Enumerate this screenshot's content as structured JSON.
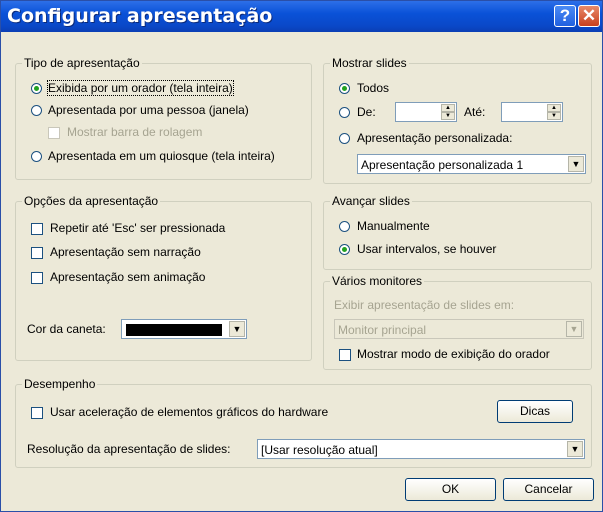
{
  "window": {
    "title": "Configurar apresentação",
    "help_icon": "help-question-icon",
    "close_icon": "close-x-icon"
  },
  "tipo": {
    "legend": "Tipo de apresentação",
    "options": [
      {
        "label": "Exibida por um orador (tela inteira)",
        "selected": true
      },
      {
        "label": "Apresentada por uma pessoa (janela)",
        "selected": false
      },
      {
        "label": "Apresentada em um quiosque (tela inteira)",
        "selected": false
      }
    ],
    "scrollbar_label": "Mostrar barra de rolagem"
  },
  "mostrar": {
    "legend": "Mostrar slides",
    "todos": "Todos",
    "de": "De:",
    "ate": "Até:",
    "personalizada": "Apresentação personalizada:",
    "personalizada_value": "Apresentação personalizada 1",
    "selected": "Todos"
  },
  "opcoes": {
    "legend": "Opções da apresentação",
    "items": [
      {
        "label": "Repetir até 'Esc' ser pressionada",
        "checked": false
      },
      {
        "label": "Apresentação sem narração",
        "checked": false
      },
      {
        "label": "Apresentação sem animação",
        "checked": false
      }
    ],
    "pen_label": "Cor da caneta:",
    "pen_color": "#000000"
  },
  "avancar": {
    "legend": "Avançar slides",
    "manual": "Manualmente",
    "intervalos": "Usar intervalos, se houver",
    "selected": "Usar intervalos, se houver"
  },
  "monitores": {
    "legend": "Vários monitores",
    "exibir_label": "Exibir apresentação de slides em:",
    "monitor_value": "Monitor principal",
    "presenter_label": "Mostrar modo de exibição do orador",
    "presenter_checked": false
  },
  "desempenho": {
    "legend": "Desempenho",
    "accel_label": "Usar aceleração de elementos gráficos do hardware",
    "accel_checked": false,
    "dicas": "Dicas",
    "res_label": "Resolução da apresentação de slides:",
    "res_value": "[Usar resolução atual]"
  },
  "footer": {
    "ok": "OK",
    "cancel": "Cancelar"
  }
}
